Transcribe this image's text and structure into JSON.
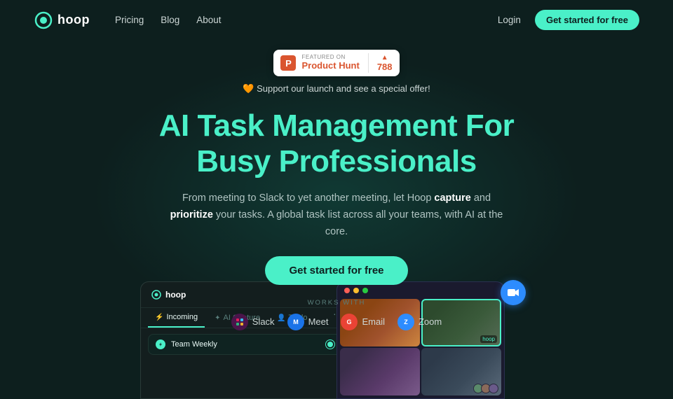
{
  "nav": {
    "logo_text": "hoop",
    "links": [
      "Pricing",
      "Blog",
      "About"
    ],
    "login": "Login",
    "cta": "Get started for free"
  },
  "product_hunt": {
    "featured_label": "FEATURED ON",
    "name": "Product Hunt",
    "count": "788"
  },
  "launch": {
    "text": "🧡 Support our launch and see a special offer!"
  },
  "hero": {
    "title_line1": "AI Task Management For",
    "title_line2": "Busy Professionals",
    "subtitle": "From meeting to Slack to yet another meeting, let Hoop",
    "capture": "capture",
    "and": "and",
    "prioritize": "prioritize",
    "subtitle2": "your tasks. A global task list across all your teams, with AI at the core.",
    "cta": "Get started for free"
  },
  "works_with": {
    "label": "WORKS WITH",
    "integrations": [
      {
        "name": "Slack",
        "emoji": "⧉"
      },
      {
        "name": "Meet",
        "emoji": "📹"
      },
      {
        "name": "Email",
        "emoji": "✉"
      },
      {
        "name": "Zoom",
        "emoji": "🎥"
      }
    ]
  },
  "hoop_app": {
    "logo": "hoop",
    "tabs": [
      {
        "label": "Incoming",
        "icon": "⚡",
        "active": true
      },
      {
        "label": "AI Capture",
        "icon": "✦",
        "active": false
      },
      {
        "label": "To do",
        "icon": "👤",
        "active": false
      }
    ],
    "task": "Team Weekly"
  },
  "video_app": {
    "person1": "👨",
    "person2": "👩",
    "person3": "👩",
    "person4": "👥",
    "label": "hoop",
    "zoom_icon": "🎥"
  }
}
